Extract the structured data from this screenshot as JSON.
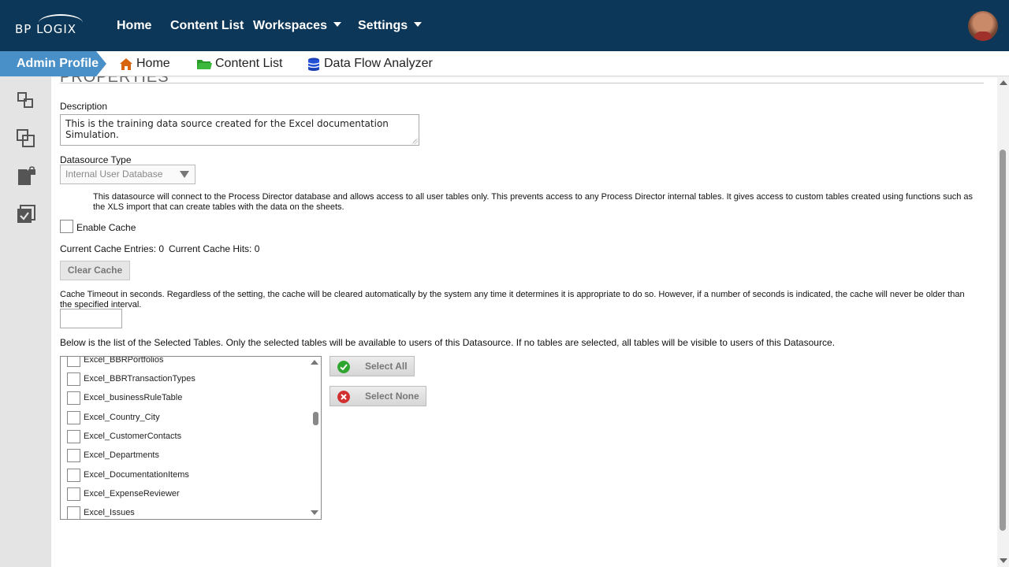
{
  "colors": {
    "header_bg": "#0c3758",
    "breadcrumb_accent": "#4a90c8",
    "sidebar_bg": "#e4e4e4"
  },
  "header": {
    "logo": "BP LOGIX",
    "nav": [
      {
        "label": "Home"
      },
      {
        "label": "Content List"
      },
      {
        "label": "Workspaces"
      },
      {
        "label": "Settings"
      }
    ]
  },
  "breadcrumb": {
    "current": "Admin Profile",
    "items": [
      {
        "label": "Home",
        "icon": "home-icon"
      },
      {
        "label": "Content List",
        "icon": "folder-icon"
      },
      {
        "label": "Data Flow Analyzer",
        "icon": "database-icon"
      }
    ]
  },
  "sidebar": {
    "icons": [
      "link-icon",
      "copy-icon",
      "lock-file-icon",
      "checklist-icon"
    ]
  },
  "form": {
    "section_title": "PROPERTIES",
    "description_label": "Description",
    "description_value": "This is the training data source created for the Excel documentation Simulation.",
    "datasource_type_label": "Datasource Type",
    "datasource_type_value": "Internal User Database",
    "datasource_info": "This datasource will connect to the Process Director database and allows access to all user tables only. This prevents access to any Process Director internal tables. It gives access to custom tables created using functions such as the XLS import that can create tables with the data on the sheets.",
    "enable_cache_label": "Enable Cache",
    "cache_entries_label": "Current Cache Entries: 0",
    "cache_hits_label": "Current Cache Hits: 0",
    "clear_cache_label": "Clear Cache",
    "cache_timeout_text": "Cache Timeout in seconds. Regardless of the setting, the cache will be cleared automatically by the system any time it determines it is appropriate to do so. However, if a number of seconds is indicated, the cache will never be older than the specified interval.",
    "cache_timeout_value": "",
    "tables_info": "Below is the list of the Selected Tables. Only the selected tables will be available to users of this Datasource. If no tables are selected, all tables will be visible to users of this Datasource.",
    "tables": [
      "Excel_BBRPortfolios",
      "Excel_BBRTransactionTypes",
      "Excel_businessRuleTable",
      "Excel_Country_City",
      "Excel_CustomerContacts",
      "Excel_Departments",
      "Excel_DocumentationItems",
      "Excel_ExpenseReviewer",
      "Excel_Issues"
    ],
    "select_all_label": "Select All",
    "select_none_label": "Select None"
  }
}
